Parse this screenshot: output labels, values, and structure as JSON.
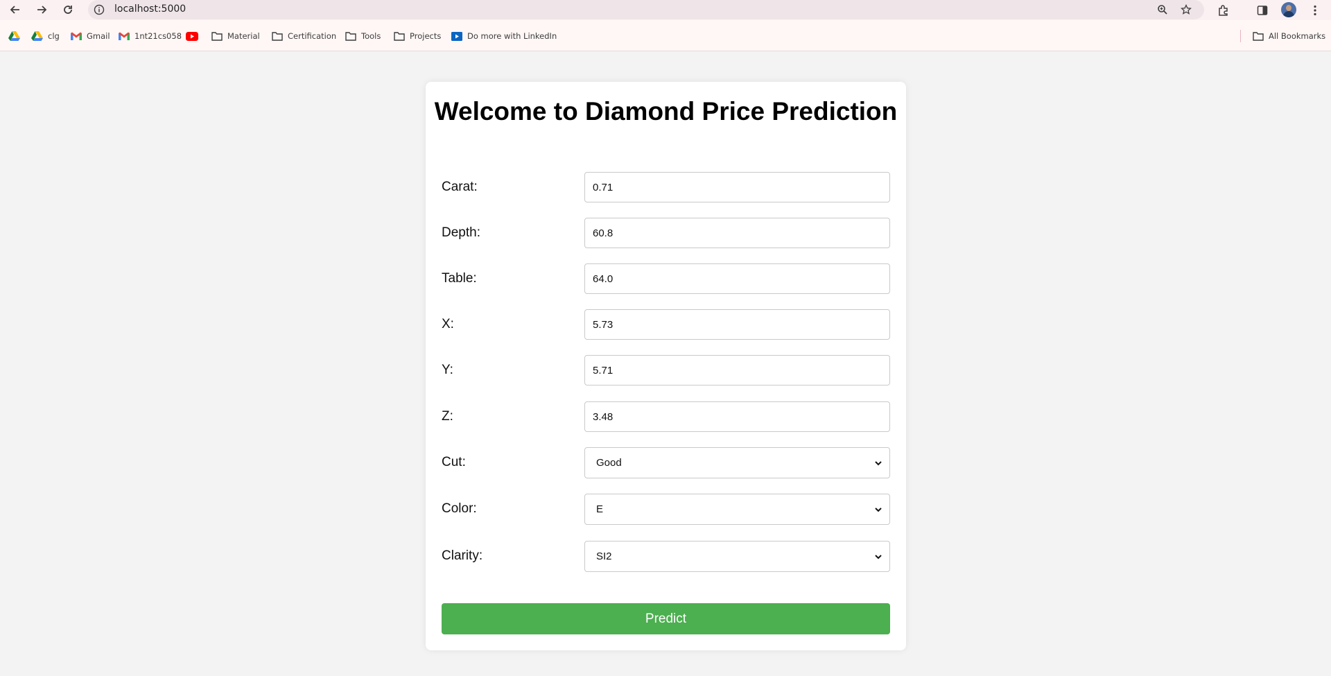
{
  "browser": {
    "url": "localhost:5000",
    "bookmarks": [
      {
        "label": "",
        "icon": "google-drive-icon"
      },
      {
        "label": "clg",
        "icon": "google-drive-icon"
      },
      {
        "label": "Gmail",
        "icon": "gmail-icon"
      },
      {
        "label": "1nt21cs058",
        "icon": "gmail-icon"
      },
      {
        "label": "",
        "icon": "youtube-icon"
      },
      {
        "label": "Material",
        "icon": "folder-icon"
      },
      {
        "label": "Certification",
        "icon": "folder-icon"
      },
      {
        "label": "Tools",
        "icon": "folder-icon"
      },
      {
        "label": "Projects",
        "icon": "folder-icon"
      },
      {
        "label": "Do more with LinkedIn",
        "icon": "linkedin-learning-icon"
      }
    ],
    "all_bookmarks_label": "All Bookmarks"
  },
  "page": {
    "title": "Welcome to Diamond Price Prediction",
    "fields": [
      {
        "label": "Carat:",
        "value": "0.71"
      },
      {
        "label": "Depth:",
        "value": "60.8"
      },
      {
        "label": "Table:",
        "value": "64.0"
      },
      {
        "label": "X:",
        "value": "5.73"
      },
      {
        "label": "Y:",
        "value": "5.71"
      },
      {
        "label": "Z:",
        "value": "3.48"
      }
    ],
    "selects": [
      {
        "label": "Cut:",
        "value": "Good"
      },
      {
        "label": "Color:",
        "value": "E"
      },
      {
        "label": "Clarity:",
        "value": "SI2"
      }
    ],
    "submit_label": "Predict"
  },
  "colors": {
    "predict_button": "#4caf50",
    "page_background": "#f3f3f3",
    "card_background": "#ffffff"
  }
}
